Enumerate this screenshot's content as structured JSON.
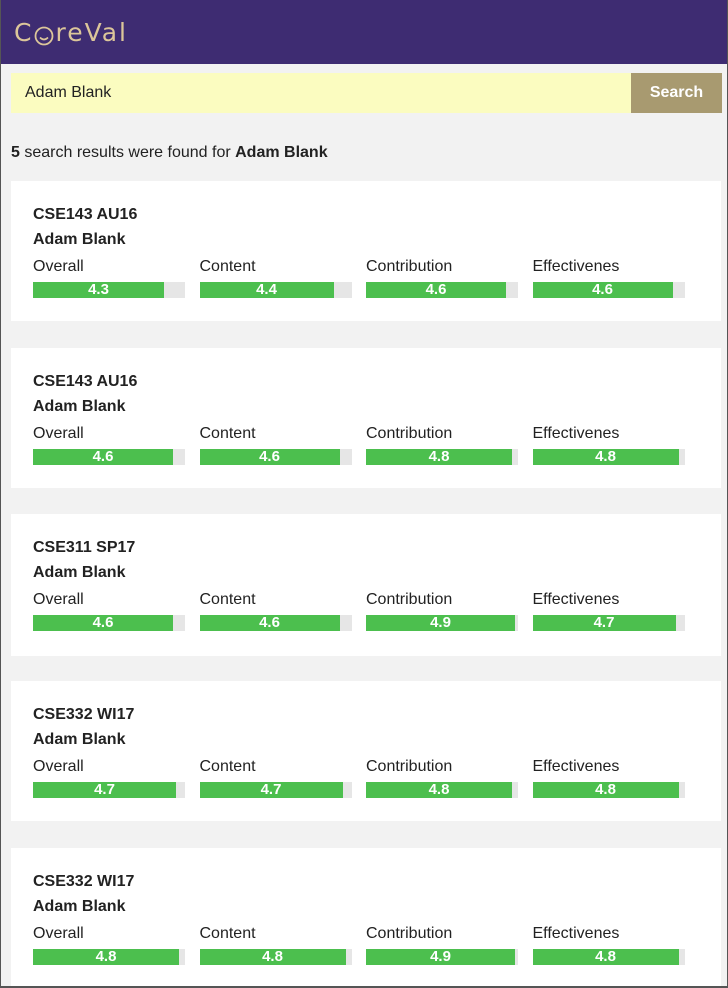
{
  "header": {
    "logo_text_before": "C",
    "logo_text_after": "reVal",
    "logo_icon": "smiley-o-icon"
  },
  "search": {
    "value": "Adam Blank",
    "button_label": "Search"
  },
  "summary": {
    "count": "5",
    "text_middle": " search results were found for ",
    "query": "Adam Blank"
  },
  "colors": {
    "header_bg": "#3e2c72",
    "logo": "#dcc69a",
    "search_bg": "#fbfcc0",
    "button_bg": "#a89a70",
    "bar_fill": "#4cbf4e",
    "bar_track": "#e6e6e6"
  },
  "metric_scale_max": 5,
  "results": [
    {
      "course": "CSE143 AU16",
      "instructor": "Adam Blank",
      "metrics": [
        {
          "label": "Overall",
          "value": "4.3"
        },
        {
          "label": "Content",
          "value": "4.4"
        },
        {
          "label": "Contribution",
          "value": "4.6"
        },
        {
          "label": "Effectivenes",
          "value": "4.6"
        }
      ]
    },
    {
      "course": "CSE143 AU16",
      "instructor": "Adam Blank",
      "metrics": [
        {
          "label": "Overall",
          "value": "4.6"
        },
        {
          "label": "Content",
          "value": "4.6"
        },
        {
          "label": "Contribution",
          "value": "4.8"
        },
        {
          "label": "Effectivenes",
          "value": "4.8"
        }
      ]
    },
    {
      "course": "CSE311 SP17",
      "instructor": "Adam Blank",
      "metrics": [
        {
          "label": "Overall",
          "value": "4.6"
        },
        {
          "label": "Content",
          "value": "4.6"
        },
        {
          "label": "Contribution",
          "value": "4.9"
        },
        {
          "label": "Effectivenes",
          "value": "4.7"
        }
      ]
    },
    {
      "course": "CSE332 WI17",
      "instructor": "Adam Blank",
      "metrics": [
        {
          "label": "Overall",
          "value": "4.7"
        },
        {
          "label": "Content",
          "value": "4.7"
        },
        {
          "label": "Contribution",
          "value": "4.8"
        },
        {
          "label": "Effectivenes",
          "value": "4.8"
        }
      ]
    },
    {
      "course": "CSE332 WI17",
      "instructor": "Adam Blank",
      "metrics": [
        {
          "label": "Overall",
          "value": "4.8"
        },
        {
          "label": "Content",
          "value": "4.8"
        },
        {
          "label": "Contribution",
          "value": "4.9"
        },
        {
          "label": "Effectivenes",
          "value": "4.8"
        }
      ]
    }
  ]
}
